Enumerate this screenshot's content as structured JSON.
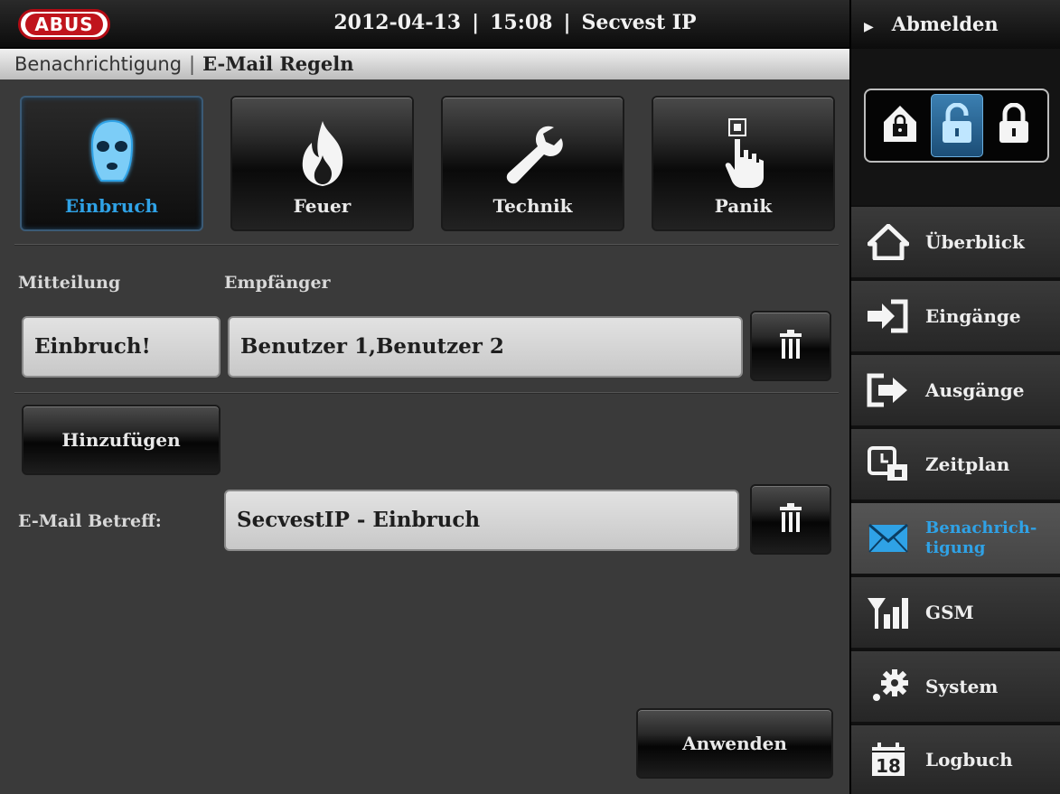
{
  "header": {
    "logo": "ABUS",
    "date": "2012-04-13",
    "time": "15:08",
    "device": "Secvest IP"
  },
  "breadcrumb": {
    "parent": "Benachrichtigung",
    "current": "E-Mail Regeln"
  },
  "categories": [
    {
      "label": "Einbruch",
      "icon": "burglar-mask-icon",
      "active": true
    },
    {
      "label": "Feuer",
      "icon": "fire-icon",
      "active": false
    },
    {
      "label": "Technik",
      "icon": "wrench-icon",
      "active": false
    },
    {
      "label": "Panik",
      "icon": "panic-button-icon",
      "active": false
    }
  ],
  "rule": {
    "message_label": "Mitteilung",
    "recipient_label": "Empfänger",
    "message_value": "Einbruch!",
    "recipient_value": "Benutzer 1,Benutzer 2"
  },
  "add_button": "Hinzufügen",
  "subject": {
    "label": "E-Mail Betreff:",
    "value": "SecvestIP - Einbruch"
  },
  "apply_button": "Anwenden",
  "sidebar": {
    "logout": "Abmelden",
    "items": [
      {
        "label": "Überblick",
        "icon": "house-icon"
      },
      {
        "label": "Eingänge",
        "icon": "entrance-icon"
      },
      {
        "label": "Ausgänge",
        "icon": "exit-icon"
      },
      {
        "label": "Zeitplan",
        "icon": "schedule-icon"
      },
      {
        "label_line1": "Benachrich-",
        "label_line2": "tigung",
        "icon": "envelope-icon",
        "active": true
      },
      {
        "label": "GSM",
        "icon": "signal-icon"
      },
      {
        "label": "System",
        "icon": "gears-icon"
      },
      {
        "label": "Logbuch",
        "icon": "calendar-icon",
        "calendar_day": "18"
      }
    ]
  },
  "colors": {
    "accent": "#2fa2e6",
    "brand_red": "#c0141c"
  }
}
